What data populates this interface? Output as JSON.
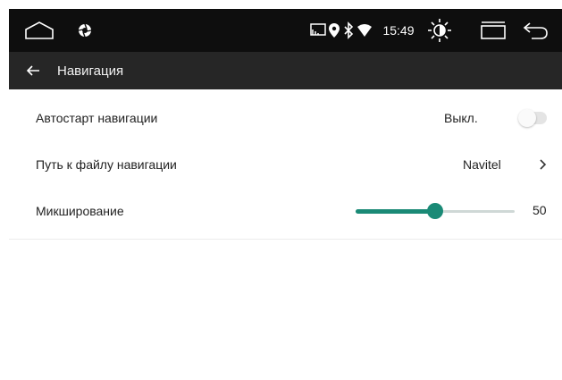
{
  "status_bar": {
    "time": "15:49"
  },
  "app_bar": {
    "title": "Навигация"
  },
  "settings": {
    "autostart": {
      "label": "Автостарт навигации",
      "value": "Выкл.",
      "enabled": false
    },
    "path": {
      "label": "Путь к файлу навигации",
      "value": "Navitel"
    },
    "mixing": {
      "label": "Микширование",
      "value": "50",
      "level": 50,
      "max": 100
    }
  },
  "colors": {
    "accent": "#1a8a76",
    "status_bar_bg": "#0e0e0e",
    "app_bar_bg": "#262626"
  },
  "icons": {
    "home": "home-icon",
    "camera": "camera-aperture-icon",
    "cast": "screen-cast-icon",
    "location": "location-pin-icon",
    "bluetooth": "bluetooth-icon",
    "wifi": "wifi-icon",
    "brightness": "brightness-icon",
    "recent": "recent-apps-icon",
    "back": "back-icon",
    "app_back": "arrow-left-icon",
    "chevron": "chevron-right-icon"
  }
}
